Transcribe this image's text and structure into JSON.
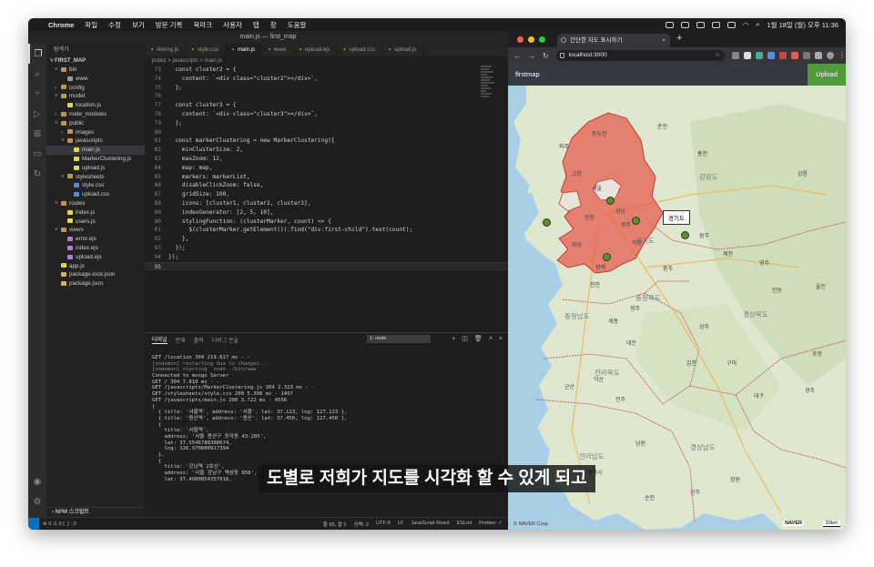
{
  "menubar": {
    "app": "Chrome",
    "items": [
      "파일",
      "수정",
      "보기",
      "방문 기록",
      "북마크",
      "사용자",
      "탭",
      "창",
      "도움말"
    ],
    "clock": "1월 18일 (월) 오후 11:36"
  },
  "vscode": {
    "title": "main.js — first_map",
    "explorer_header": "탐색기",
    "project": "FIRST_MAP",
    "tree": [
      {
        "label": "bin",
        "depth": 1,
        "kind": "folder-open"
      },
      {
        "label": "www",
        "depth": 2,
        "kind": "file"
      },
      {
        "label": "config",
        "depth": 1,
        "kind": "folder"
      },
      {
        "label": "model",
        "depth": 1,
        "kind": "folder-open"
      },
      {
        "label": "location.js",
        "depth": 2,
        "kind": "js"
      },
      {
        "label": "node_modules",
        "depth": 1,
        "kind": "folder"
      },
      {
        "label": "public",
        "depth": 1,
        "kind": "folder-open"
      },
      {
        "label": "images",
        "depth": 2,
        "kind": "folder"
      },
      {
        "label": "javascripts",
        "depth": 2,
        "kind": "folder-open"
      },
      {
        "label": "main.js",
        "depth": 3,
        "kind": "js",
        "selected": true
      },
      {
        "label": "MarkerClustering.js",
        "depth": 3,
        "kind": "js"
      },
      {
        "label": "upload.js",
        "depth": 3,
        "kind": "js"
      },
      {
        "label": "stylesheets",
        "depth": 2,
        "kind": "folder-open"
      },
      {
        "label": "style.css",
        "depth": 3,
        "kind": "css"
      },
      {
        "label": "upload.css",
        "depth": 3,
        "kind": "css"
      },
      {
        "label": "routes",
        "depth": 1,
        "kind": "folder-open"
      },
      {
        "label": "index.js",
        "depth": 2,
        "kind": "js"
      },
      {
        "label": "users.js",
        "depth": 2,
        "kind": "js"
      },
      {
        "label": "views",
        "depth": 1,
        "kind": "folder-open"
      },
      {
        "label": "error.ejs",
        "depth": 2,
        "kind": "ejs"
      },
      {
        "label": "index.ejs",
        "depth": 2,
        "kind": "ejs"
      },
      {
        "label": "upload.ejs",
        "depth": 2,
        "kind": "ejs"
      },
      {
        "label": "app.js",
        "depth": 1,
        "kind": "js"
      },
      {
        "label": "package-lock.json",
        "depth": 1,
        "kind": "json"
      },
      {
        "label": "package.json",
        "depth": 1,
        "kind": "json"
      }
    ],
    "npm_scripts": "NPM 스크립트",
    "tabs": [
      {
        "label": "stering.js",
        "active": false
      },
      {
        "label": "style.css",
        "active": false
      },
      {
        "label": "main.js",
        "active": true
      },
      {
        "label": "www",
        "active": false
      },
      {
        "label": "upload.ejs",
        "active": false
      },
      {
        "label": "upload.css",
        "active": false
      },
      {
        "label": "upload.js",
        "active": false
      }
    ],
    "breadcrumb": "public > javascripts > main.js",
    "code": [
      {
        "n": "73",
        "t": "  const cluster2 = {"
      },
      {
        "n": "74",
        "t": "    content: `<div class=\"cluster2\"></div>`,"
      },
      {
        "n": "75",
        "t": "  };"
      },
      {
        "n": "76",
        "t": ""
      },
      {
        "n": "77",
        "t": "  const cluster3 = {"
      },
      {
        "n": "78",
        "t": "    content: `<div class=\"cluster3\"></div>`,"
      },
      {
        "n": "79",
        "t": "  };"
      },
      {
        "n": "80",
        "t": ""
      },
      {
        "n": "81",
        "t": "  const markerClustering = new MarkerClustering({"
      },
      {
        "n": "82",
        "t": "    minClusterSize: 2,"
      },
      {
        "n": "83",
        "t": "    maxZoom: 12,"
      },
      {
        "n": "84",
        "t": "    map: map,"
      },
      {
        "n": "85",
        "t": "    markers: markerList,"
      },
      {
        "n": "86",
        "t": "    disableClickZoom: false,"
      },
      {
        "n": "87",
        "t": "    gridSize: 100,"
      },
      {
        "n": "88",
        "t": "    icons: [cluster1, cluster2, cluster3],"
      },
      {
        "n": "89",
        "t": "    indexGenerator: [2, 5, 10],"
      },
      {
        "n": "90",
        "t": "    stylingFunction: (clusterMarker, count) => {"
      },
      {
        "n": "91",
        "t": "      $(clusterMarker.getElement()).find(\"div:first-child\").text(count);"
      },
      {
        "n": "92",
        "t": "    },"
      },
      {
        "n": "93",
        "t": "  });"
      },
      {
        "n": "94",
        "t": "});"
      },
      {
        "n": "95",
        "t": "",
        "current": true
      }
    ],
    "panel_tabs": [
      "터미널",
      "문제",
      "출력",
      "디버그 콘솔"
    ],
    "terminal_select": "1: node",
    "terminal": [
      {
        "t": "GET /location 304 219.617 ms - -",
        "dim": false
      },
      {
        "t": "[nodemon] restarting due to changes...",
        "dim": true
      },
      {
        "t": "[nodemon] starting `node ./bin/www`",
        "dim": true
      },
      {
        "t": "Connected to mongo Server",
        "dim": false
      },
      {
        "t": "GET / 304 7.810 ms - -",
        "dim": false
      },
      {
        "t": "GET /javascripts/MarkerClustering.js 304 2.323 ms - -",
        "dim": false
      },
      {
        "t": "GET /stylesheets/style.css 200 5.308 ms - 1497",
        "dim": false
      },
      {
        "t": "GET /javascripts/main.js 200 3.722 ms - 4556",
        "dim": false
      },
      {
        "t": "[",
        "dim": false
      },
      {
        "t": "  { title: '서울역', address: '서울', lat: 37.123, lng: 127.123 },",
        "dim": false
      },
      {
        "t": "  { title: '용산역', address: '용산', lat: 37.456, lng: 127.456 },",
        "dim": false
      },
      {
        "t": "  {",
        "dim": false
      },
      {
        "t": "    title: '서울역',",
        "dim": false
      },
      {
        "t": "    address: '서울 용산구 동자동 43-205',",
        "dim": false
      },
      {
        "t": "    lat: 37.5546788388674,",
        "dim": false
      },
      {
        "t": "    lng: 126.970600917394",
        "dim": false
      },
      {
        "t": "  },",
        "dim": false
      },
      {
        "t": "  {",
        "dim": false
      },
      {
        "t": "    title: '강남역 2호선',",
        "dim": false
      },
      {
        "t": "    address: '서울 강남구 역삼동 858',",
        "dim": false
      },
      {
        "t": "    lat: 37.4980854357918,",
        "dim": false
      }
    ],
    "status": {
      "left": "⊗ 0 ⚠ 0   { .} : 0",
      "items": [
        "줄 95, 열 1",
        "공백: 2",
        "UTF-8",
        "LF",
        "JavaScript React",
        "ESLint",
        "Prettier: ✓"
      ]
    }
  },
  "chrome": {
    "tab_title": "간단한 지도 표시하기",
    "url": "localhost:3000",
    "brand": "flrstmap",
    "upload_label": "Upload",
    "tooltip": "경기도",
    "copyright": "© NAVER Corp.",
    "naver_logo": "NAVER",
    "scale": "30km",
    "provinces": [
      "강원도",
      "경기도",
      "충청북도",
      "충청남도",
      "경상북도",
      "전라북도",
      "경상남도",
      "전라남도"
    ],
    "cities": [
      "서울",
      "동두천",
      "파주",
      "안양",
      "성남",
      "광주",
      "이천",
      "평택",
      "화성",
      "고양",
      "강릉",
      "홍천",
      "원주",
      "춘천",
      "충주",
      "제천",
      "청주",
      "천안",
      "세종",
      "대전",
      "상주",
      "안동",
      "구미",
      "대구",
      "경주",
      "김천",
      "전주",
      "군산",
      "익산",
      "광주광역시",
      "창원",
      "진주",
      "남원",
      "순천",
      "울진",
      "영주",
      "포항"
    ],
    "marker_color": "#5e8c31",
    "region_color": "#e8574a"
  },
  "subtitle": "도별로 저희가 지도를 시각화 할 수 있게 되고"
}
